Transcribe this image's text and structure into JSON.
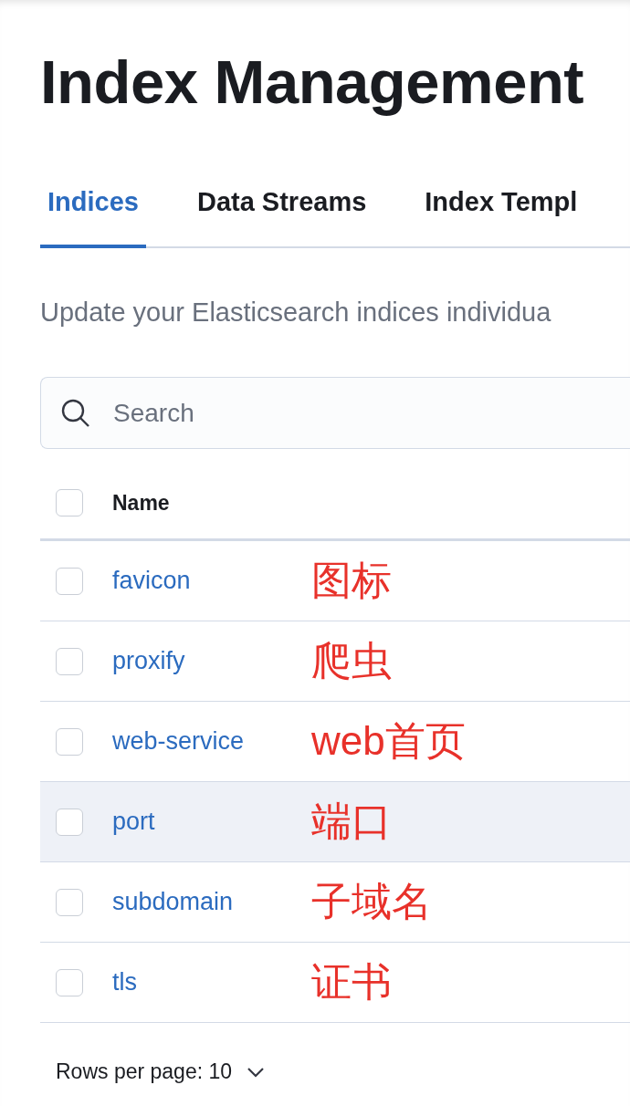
{
  "title": "Index Management",
  "tabs": [
    {
      "label": "Indices",
      "selected": true
    },
    {
      "label": "Data Streams",
      "selected": false
    },
    {
      "label": "Index Templ",
      "selected": false
    }
  ],
  "description": "Update your Elasticsearch indices individua",
  "search": {
    "placeholder": "Search"
  },
  "table": {
    "select_all_checked": false,
    "columns": [
      "Name"
    ],
    "rows": [
      {
        "name": "favicon",
        "annotation": "图标",
        "checked": false,
        "hovered": false
      },
      {
        "name": "proxify",
        "annotation": "爬虫",
        "checked": false,
        "hovered": false
      },
      {
        "name": "web-service",
        "annotation": "web首页",
        "checked": false,
        "hovered": false
      },
      {
        "name": "port",
        "annotation": "端口",
        "checked": false,
        "hovered": true
      },
      {
        "name": "subdomain",
        "annotation": "子域名",
        "checked": false,
        "hovered": false
      },
      {
        "name": "tls",
        "annotation": "证书",
        "checked": false,
        "hovered": false
      }
    ]
  },
  "pagination": {
    "rows_per_page": "Rows per page: 10"
  }
}
